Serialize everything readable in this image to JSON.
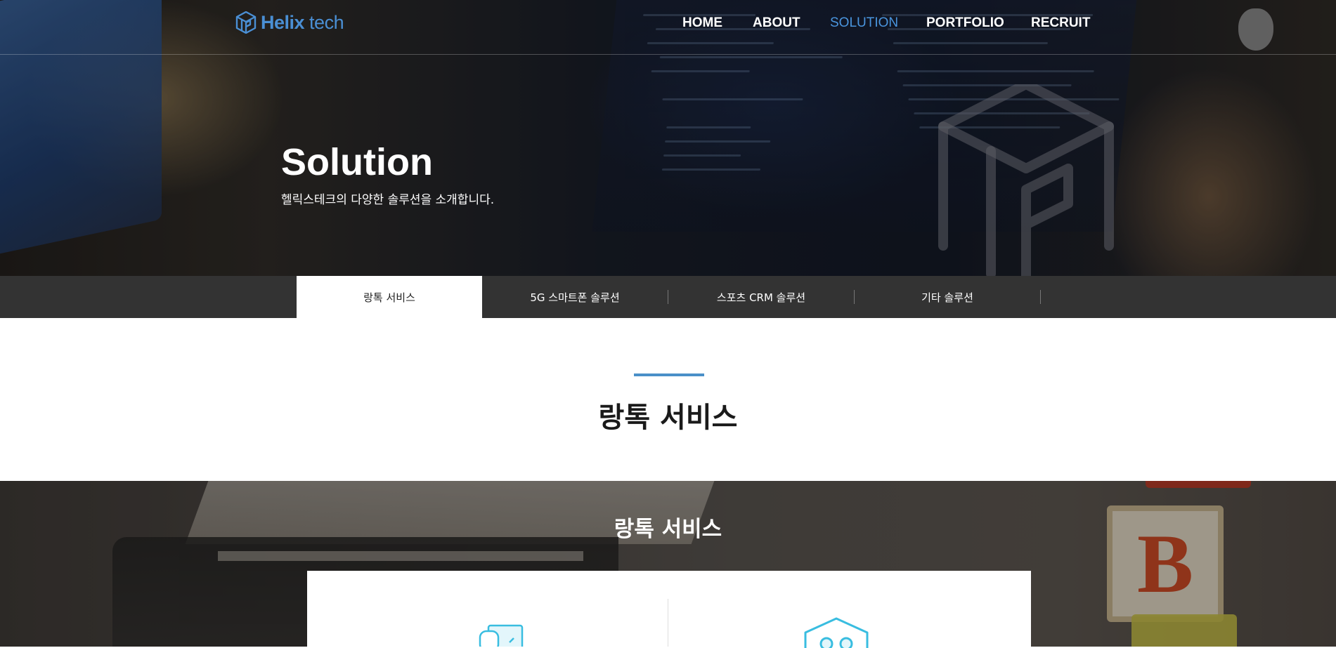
{
  "header": {
    "logo": {
      "bold": "Helix",
      "light": " tech"
    },
    "nav": [
      {
        "label": "HOME",
        "active": false
      },
      {
        "label": "ABOUT",
        "active": false
      },
      {
        "label": "SOLUTION",
        "active": true
      },
      {
        "label": "PORTFOLIO",
        "active": false
      },
      {
        "label": "RECRUIT",
        "active": false
      }
    ]
  },
  "hero": {
    "title": "Solution",
    "subtitle": "헬릭스테크의 다양한 솔루션을 소개합니다."
  },
  "tabs": [
    {
      "label": "랑톡 서비스",
      "active": true
    },
    {
      "label": "5G 스마트폰 솔루션",
      "active": false
    },
    {
      "label": "스포츠 CRM 솔루션",
      "active": false
    },
    {
      "label": "기타 솔루션",
      "active": false
    }
  ],
  "section": {
    "title": "랑톡 서비스"
  },
  "band": {
    "title": "랑톡 서비스",
    "block_letter": "B"
  },
  "colors": {
    "accent": "#4a90c8",
    "logo": "#4a8fd4",
    "nav_active": "#4a95de",
    "tabbar": "#333333",
    "icon": "#39bde0"
  },
  "icons": [
    "helix-logo-icon",
    "chat-bubbles-icon",
    "robot-house-icon"
  ]
}
